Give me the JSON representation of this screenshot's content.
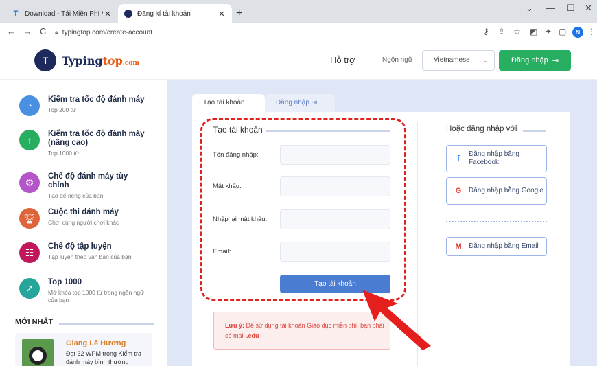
{
  "browser": {
    "tabs": [
      {
        "title": "Download - Tải Miễn Phí VN - Ph",
        "active": false
      },
      {
        "title": "Đăng kí tài khoản",
        "active": true
      }
    ],
    "url": "typingtop.com/create-account",
    "profile_initial": "N"
  },
  "header": {
    "logo_main": "Typing",
    "logo_accent": "top",
    "logo_suffix": ".com",
    "support": "Hỗ trợ",
    "language_label": "Ngôn ngữ",
    "language_value": "Vietnamese",
    "login_button": "Đăng nhập"
  },
  "sidebar": {
    "items": [
      {
        "title": "Kiểm tra tốc độ đánh máy",
        "sub": "Top 200 từ",
        "color": "#4a90e2"
      },
      {
        "title": "Kiểm tra tốc độ đánh máy (nâng cao)",
        "sub": "Top 1000 từ",
        "color": "#27ae60"
      },
      {
        "title": "Chế độ đánh máy tùy chỉnh",
        "sub": "Tạo để riêng của bạn",
        "color": "#b455c9"
      },
      {
        "title": "Cuộc thi đánh máy",
        "sub": "Chơi cùng người chơi khác",
        "color": "#e0643a"
      },
      {
        "title": "Chế độ tập luyện",
        "sub": "Tập luyện theo văn bản của bạn",
        "color": "#c2185b"
      },
      {
        "title": "Top 1000",
        "sub": "Mở khóa top 1000 từ trong ngôn ngữ của bạn",
        "color": "#26a69a"
      }
    ],
    "latest_title": "MỚI NHẤT",
    "latest": {
      "name": "Giang Lê Hương",
      "desc": "Đạt 32 WPM trong Kiểm tra đánh máy bình thường"
    }
  },
  "tabs": {
    "create": "Tạo tài khoản",
    "login": "Đăng nhập"
  },
  "form": {
    "title": "Tạo tài khoản",
    "fields": [
      {
        "label": "Tên đăng nhập:",
        "value": ""
      },
      {
        "label": "Mật khẩu:",
        "value": ""
      },
      {
        "label": "Nhập lại mật khẩu:",
        "value": ""
      },
      {
        "label": "Email:",
        "value": ""
      }
    ],
    "submit": "Tạo tài khoản"
  },
  "note": {
    "prefix": "Lưu ý:",
    "text": " Để sử dụng tài khoản Giáo dục miễn phí, bạn phải có mail ",
    "suffix": ".edu"
  },
  "social": {
    "title": "Hoặc đăng nhập với",
    "facebook": "Đăng nhập bằng Facebook",
    "google": "Đăng nhập bằng Google",
    "email": "Đăng nhập bằng Email"
  },
  "colors": {
    "accent_green": "#27ae60",
    "primary_blue": "#4a7cd1",
    "highlight_red": "#e0231f"
  }
}
